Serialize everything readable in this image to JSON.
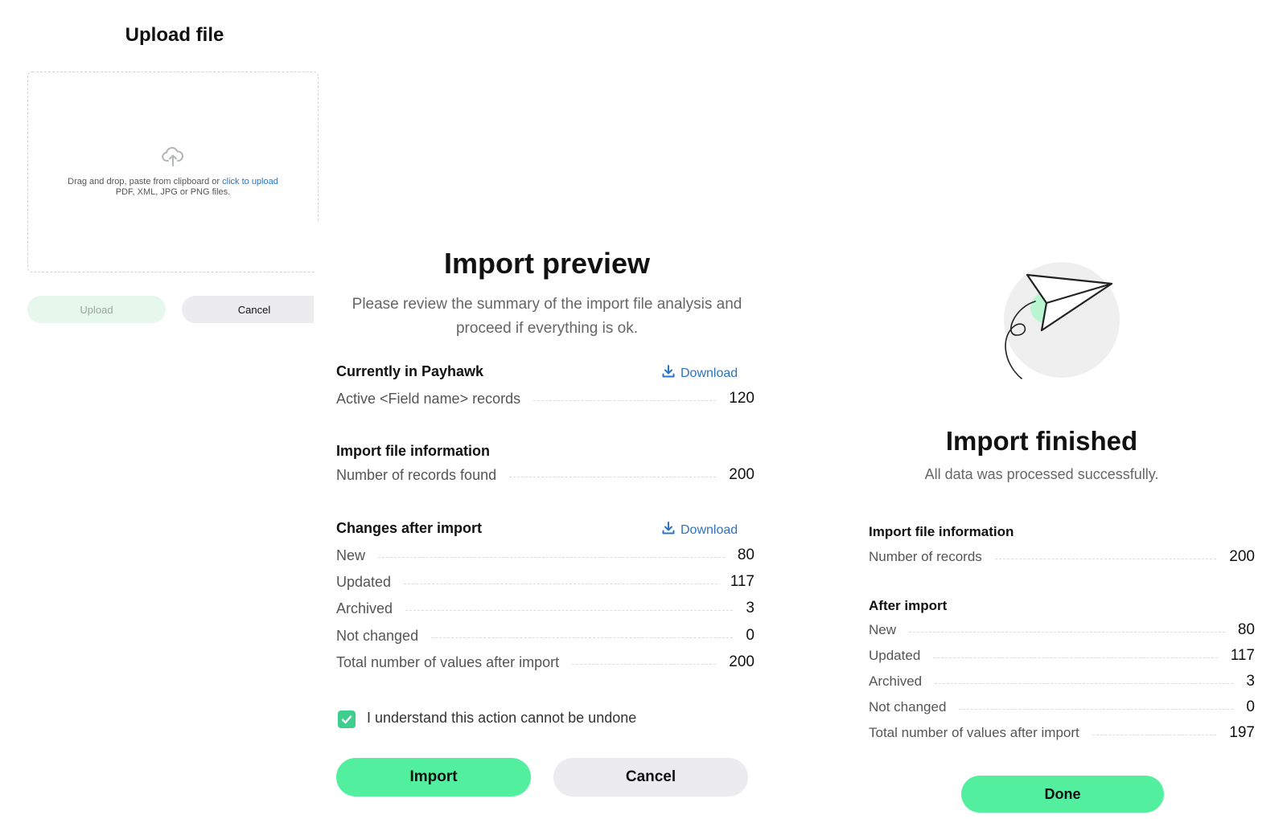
{
  "upload": {
    "title": "Upload file",
    "dropzone_text": "Drag and drop, paste from clipboard or",
    "dropzone_link": "click to upload",
    "dropzone_formats": "PDF, XML, JPG or PNG files.",
    "upload_label": "Upload",
    "cancel_label": "Cancel",
    "icon": "cloud-upload-icon"
  },
  "preview": {
    "title": "Import preview",
    "subtitle_line1": "Please review the summary of the import file analysis and",
    "subtitle_line2": "proceed if everything is ok.",
    "download_label": "Download",
    "current": {
      "heading": "Currently in Payhawk",
      "rows": [
        {
          "label": "Active <Field name> records",
          "value": "120"
        }
      ]
    },
    "file_info": {
      "heading": "Import file information",
      "rows": [
        {
          "label": "Number of records found",
          "value": "200"
        }
      ]
    },
    "changes": {
      "heading": "Changes after import",
      "rows": [
        {
          "label": "New",
          "value": "80"
        },
        {
          "label": "Updated",
          "value": "117"
        },
        {
          "label": "Archived",
          "value": "3"
        },
        {
          "label": "Not changed",
          "value": "0"
        },
        {
          "label": "Total number of values after import",
          "value": "200"
        }
      ]
    },
    "confirm_label": "I understand this action cannot be undone",
    "confirm_checked": true,
    "import_label": "Import",
    "cancel_label": "Cancel"
  },
  "finished": {
    "title": "Import finished",
    "subtitle": "All data was processed successfully.",
    "file_info": {
      "heading": "Import file information",
      "rows": [
        {
          "label": "Number of records",
          "value": "200"
        }
      ]
    },
    "after": {
      "heading": "After import",
      "rows": [
        {
          "label": "New",
          "value": "80"
        },
        {
          "label": "Updated",
          "value": "117"
        },
        {
          "label": "Archived",
          "value": "3"
        },
        {
          "label": "Not changed",
          "value": "0"
        },
        {
          "label": "Total number of values after import",
          "value": "197"
        }
      ]
    },
    "done_label": "Done",
    "illustration": "paper-plane-icon"
  },
  "colors": {
    "accent_green": "#52ef9f",
    "link_blue": "#2a73c5",
    "check_green": "#3ecf8e",
    "light_green": "#e6f8ec",
    "neutral_button": "#ececee"
  }
}
